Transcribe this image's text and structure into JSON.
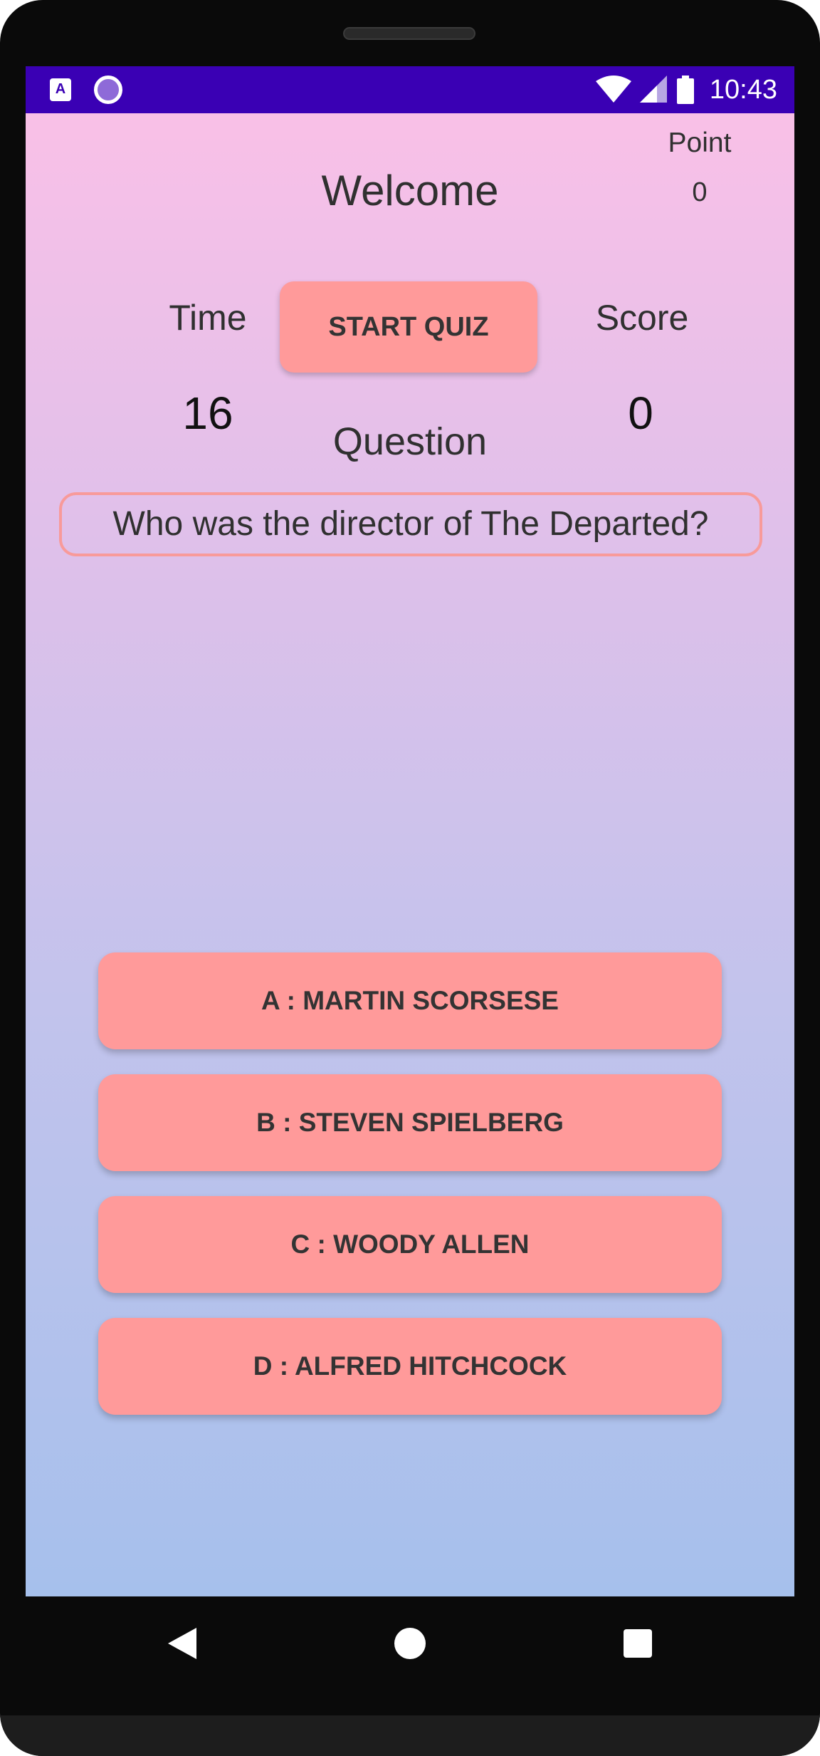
{
  "status_bar": {
    "time": "10:43",
    "left_icons": [
      "a-notification-icon",
      "circle-notification-icon"
    ],
    "right_icons": [
      "wifi-icon",
      "cell-signal-icon",
      "battery-icon"
    ],
    "a_icon_glyph": "A"
  },
  "header": {
    "welcome": "Welcome",
    "point_label": "Point",
    "point_value": "0"
  },
  "stats": {
    "time_label": "Time",
    "time_value": "16",
    "score_label": "Score",
    "score_value": "0"
  },
  "start_button": {
    "label": "START QUIZ"
  },
  "question": {
    "label": "Question",
    "text": "Who was the director of The Departed?"
  },
  "answers": [
    {
      "label": "A : MARTIN SCORSESE"
    },
    {
      "label": "B : STEVEN SPIELBERG"
    },
    {
      "label": "C : WOODY ALLEN"
    },
    {
      "label": "D : ALFRED HITCHCOCK"
    }
  ],
  "nav": {
    "icons": [
      "back-icon",
      "home-icon",
      "recents-icon"
    ]
  },
  "colors": {
    "status_bar": "#3a00b4",
    "button": "#ff9a9a",
    "question_border": "#f89a9a",
    "gradient_top": "#f9c0e7",
    "gradient_bottom": "#a6c0ec",
    "text": "#303030"
  }
}
